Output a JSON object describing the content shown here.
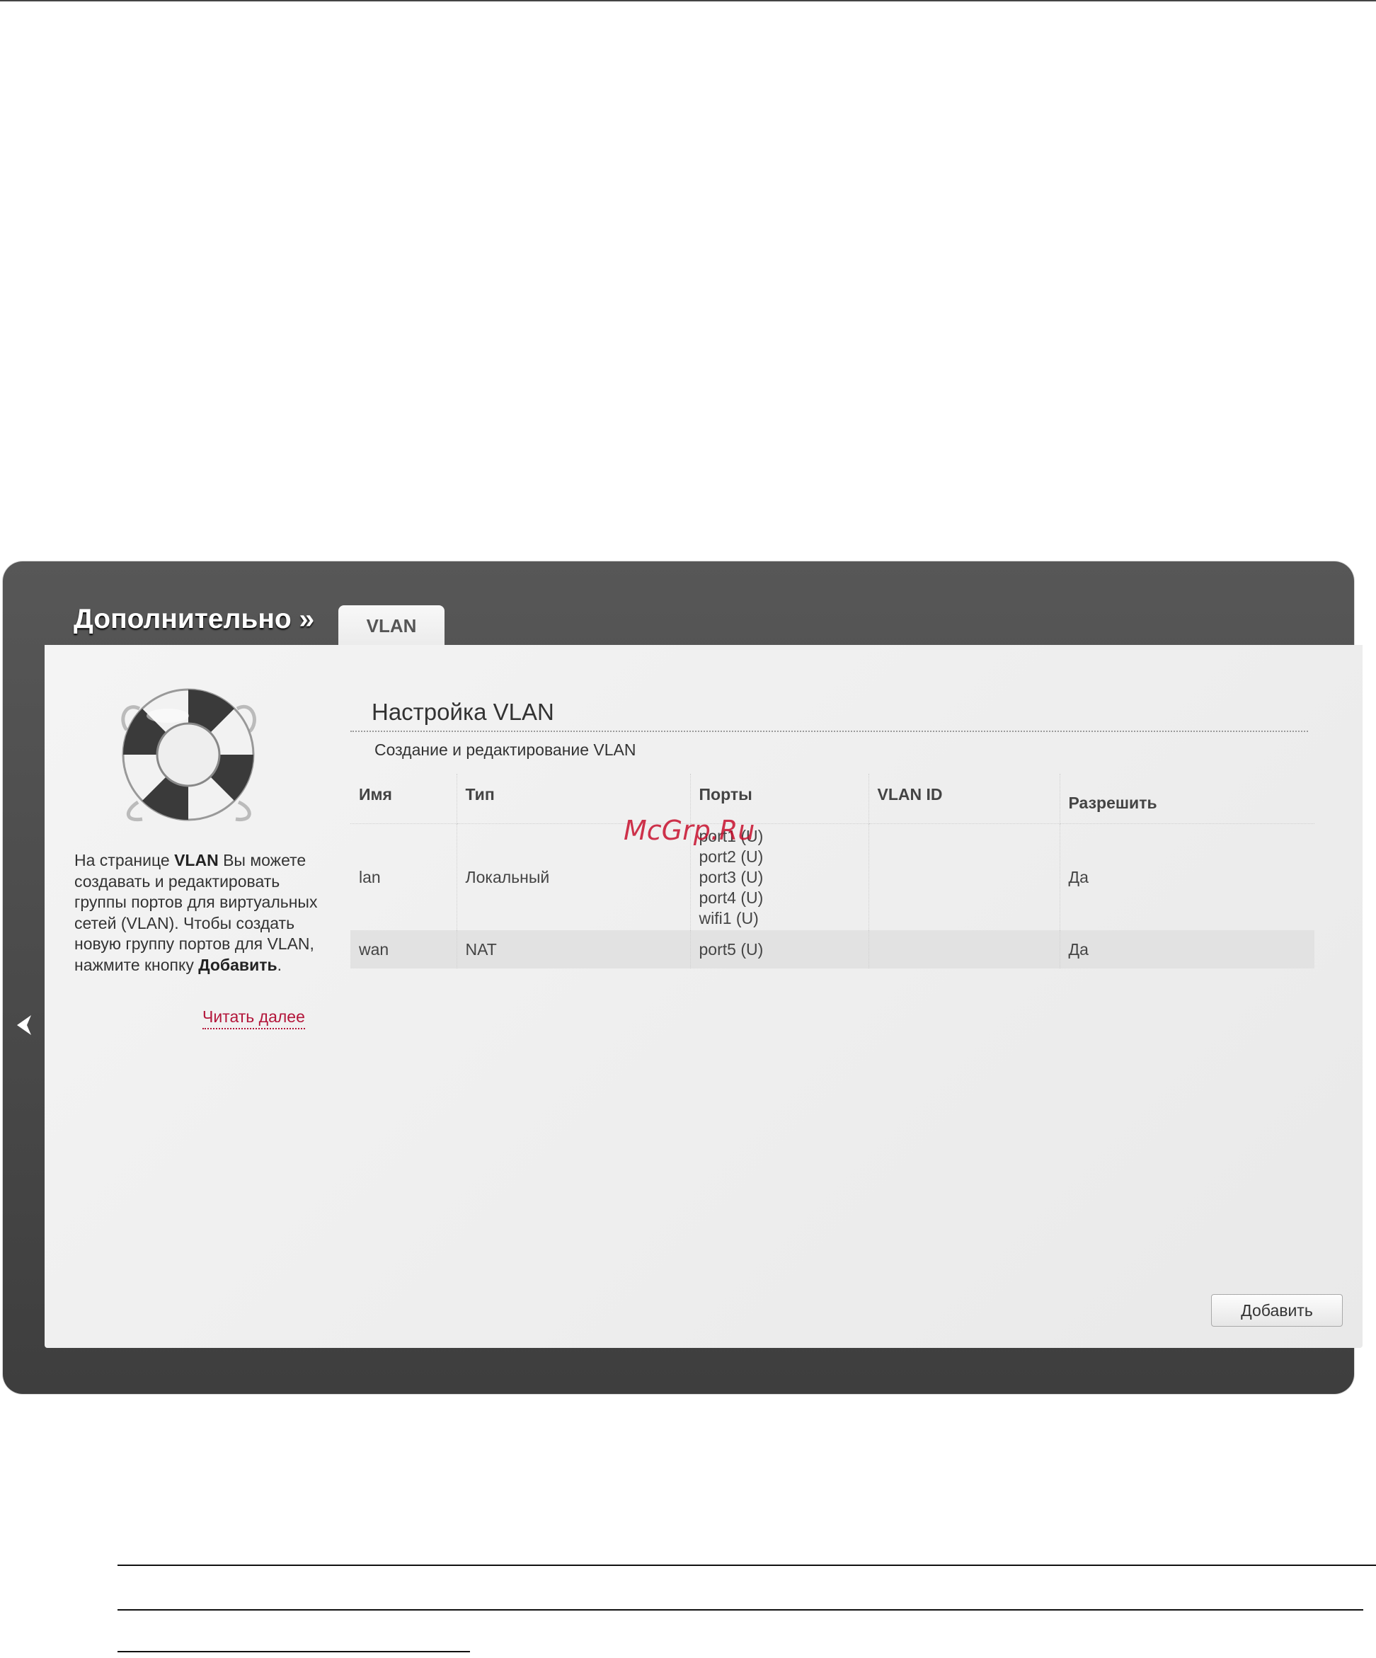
{
  "header": {
    "section_title": "Дополнительно »",
    "active_tab": "VLAN"
  },
  "help": {
    "text_html_parts": [
      {
        "t": "На странице ",
        "b": false
      },
      {
        "t": "VLAN",
        "b": true
      },
      {
        "t": " Вы можете создавать и редактировать группы портов для виртуальных сетей (VLAN). Чтобы создать новую группу портов для VLAN, нажмите кнопку ",
        "b": false
      },
      {
        "t": "Добавить",
        "b": true
      },
      {
        "t": ".",
        "b": false
      }
    ],
    "read_more": "Читать далее"
  },
  "main": {
    "title": "Настройка VLAN",
    "subtitle": "Создание и редактирование VLAN",
    "columns": [
      "Имя",
      "Тип",
      "Порты",
      "VLAN ID",
      "Разрешить"
    ],
    "rows": [
      {
        "name": "lan",
        "type": "Локальный",
        "ports": [
          "port1 (U)",
          "port2 (U)",
          "port3 (U)",
          "port4 (U)",
          "wifi1 (U)"
        ],
        "vlan_id": "",
        "allow": "Да"
      },
      {
        "name": "wan",
        "type": "NAT",
        "ports": [
          "port5 (U)"
        ],
        "vlan_id": "",
        "allow": "Да"
      }
    ],
    "add_button": "Добавить"
  },
  "watermark": "McGrp.Ru",
  "icons": {
    "back": "chevron-left-icon",
    "help": "lifebuoy-icon"
  }
}
